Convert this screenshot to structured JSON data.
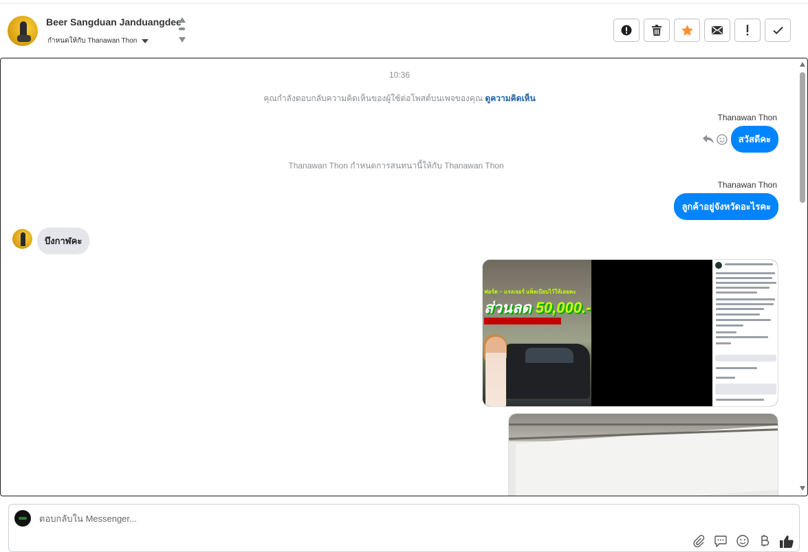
{
  "header": {
    "contact_name": "Beer Sangduan Janduangdee",
    "assigned_label": "กำหนดให้กับ Thanawan Thon"
  },
  "actions": [
    {
      "name": "report-spam-button",
      "icon": "alert-circle-icon"
    },
    {
      "name": "delete-button",
      "icon": "trash-icon"
    },
    {
      "name": "star-button",
      "icon": "star-icon"
    },
    {
      "name": "mark-unread-button",
      "icon": "envelope-icon"
    },
    {
      "name": "flag-button",
      "icon": "exclamation-icon"
    },
    {
      "name": "mark-done-button",
      "icon": "checkmark-icon"
    }
  ],
  "colors": {
    "accent": "#0084ff",
    "star": "#f7923b",
    "link": "#1b5fa8"
  },
  "chat": {
    "timestamp": "10:36",
    "reply_notice": "คุณกำลังตอบกลับความคิดเห็นของผู้ใช้ต่อโพสต์บนเพจของคุณ",
    "view_comment_link": "ดูความคิดเห็น",
    "messages": [
      {
        "sender": "Thanawan Thon",
        "text": "สวัสดีคะ"
      },
      {
        "sender": "Thanawan Thon",
        "text": "ลูกค้าอยู่จังหวัดอะไรคะ"
      }
    ],
    "assignment_note": "Thanawan Thon กำหนดการสนทนานี้ให้กับ Thanawan Thon",
    "incoming_message": "บึงกาฬคะ",
    "image_headline_1": "ฟอร์ด – แรงเจอร์ แพ็ลเบียบไว้ให้เลยคะ",
    "image_headline_2a": "ส่วนลด ",
    "image_headline_2b": "50,000.-"
  },
  "composer": {
    "placeholder": "ตอบกลับใน Messenger..."
  }
}
